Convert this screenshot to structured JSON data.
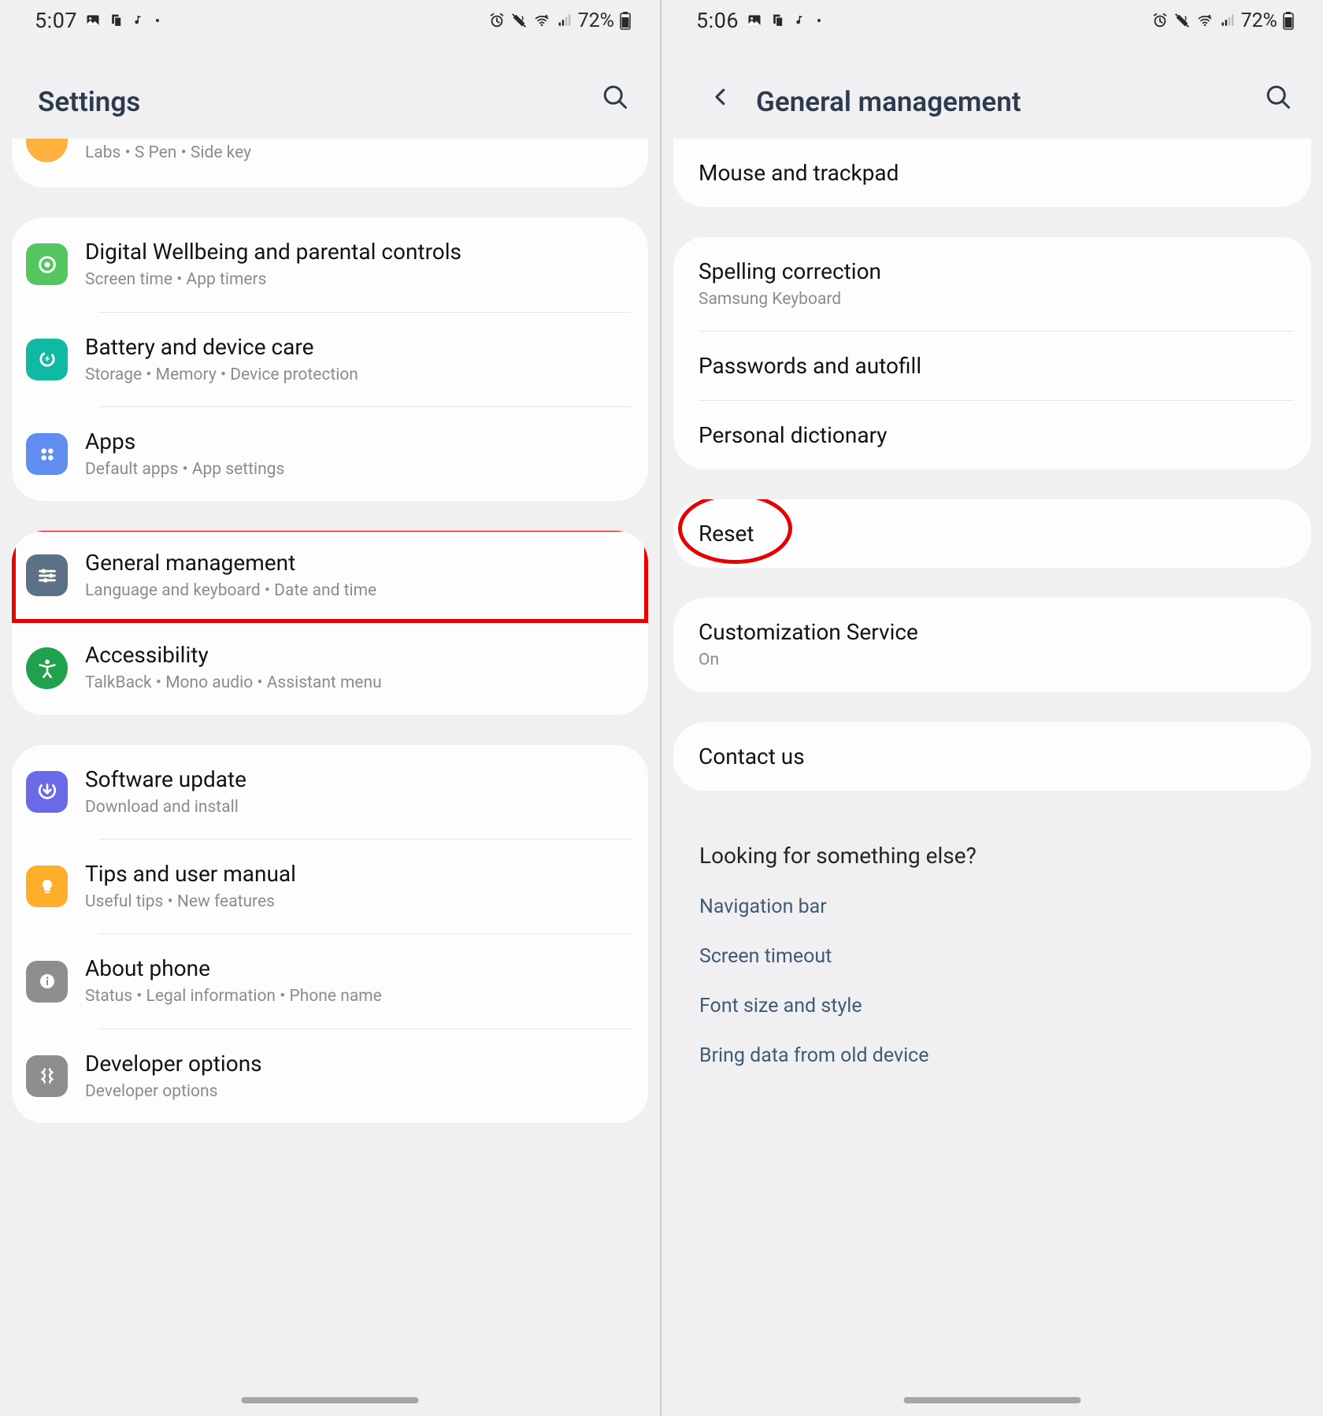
{
  "left": {
    "status": {
      "time": "5:07",
      "battery": "72%"
    },
    "title": "Settings",
    "partial": {
      "sub": "Labs  •  S Pen  •  Side key"
    },
    "group1": [
      {
        "title": "Digital Wellbeing and parental controls",
        "sub": "Screen time  •  App timers",
        "color": "#53c65f"
      },
      {
        "title": "Battery and device care",
        "sub": "Storage  •  Memory  •  Device protection",
        "color": "#10b9a2"
      },
      {
        "title": "Apps",
        "sub": "Default apps  •  App settings",
        "color": "#5f8ef0"
      }
    ],
    "group2": [
      {
        "title": "General management",
        "sub": "Language and keyboard  •  Date and time",
        "color": "#5c7184",
        "highlight": true
      },
      {
        "title": "Accessibility",
        "sub": "TalkBack  •  Mono audio  •  Assistant menu",
        "color": "#1fa14d"
      }
    ],
    "group3": [
      {
        "title": "Software update",
        "sub": "Download and install",
        "color": "#6a6ae8"
      },
      {
        "title": "Tips and user manual",
        "sub": "Useful tips  •  New features",
        "color": "#ffae2a"
      },
      {
        "title": "About phone",
        "sub": "Status  •  Legal information  •  Phone name",
        "color": "#8e8e8e"
      },
      {
        "title": "Developer options",
        "sub": "Developer options",
        "color": "#8e8e8e"
      }
    ]
  },
  "right": {
    "status": {
      "time": "5:06",
      "battery": "72%"
    },
    "title": "General management",
    "group1": [
      {
        "title": "Mouse and trackpad"
      }
    ],
    "group2": [
      {
        "title": "Spelling correction",
        "sub": "Samsung Keyboard"
      },
      {
        "title": "Passwords and autofill"
      },
      {
        "title": "Personal dictionary"
      }
    ],
    "group3": [
      {
        "title": "Reset",
        "highlight": true
      }
    ],
    "group4": [
      {
        "title": "Customization Service",
        "sub": "On"
      }
    ],
    "group5": [
      {
        "title": "Contact us"
      }
    ],
    "footer": {
      "title": "Looking for something else?",
      "links": [
        "Navigation bar",
        "Screen timeout",
        "Font size and style",
        "Bring data from old device"
      ]
    }
  }
}
